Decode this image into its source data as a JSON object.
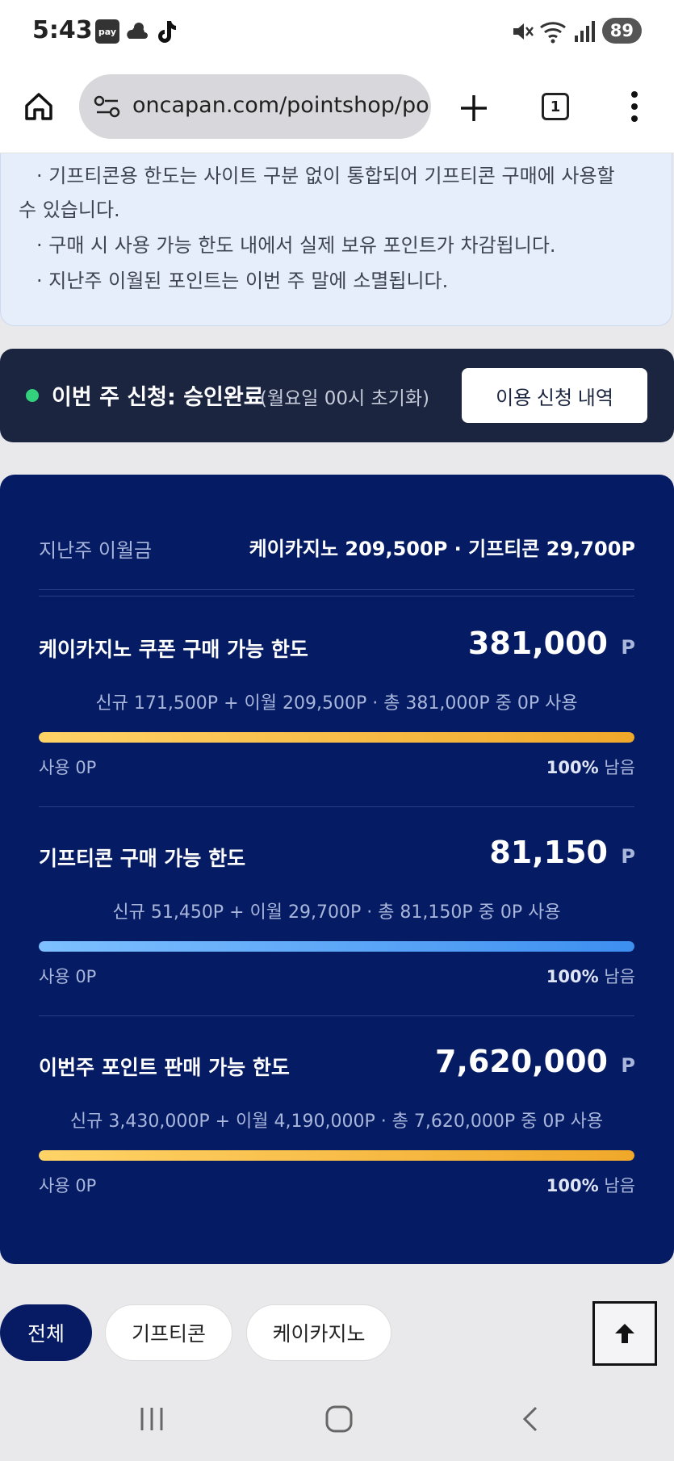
{
  "status_bar": {
    "time": "5:43",
    "pay_badge": "pay",
    "battery": "89"
  },
  "browser": {
    "url": "oncapan.com/pointshop/point",
    "tab_count": "1"
  },
  "notice": {
    "lines": [
      "· 기프티콘용 한도는 사이트 구분 없이 통합되어 기프티콘 구매에 사용할",
      "수 있습니다.",
      "· 구매 시 사용 가능 한도 내에서 실제 보유 포인트가 차감됩니다.",
      "· 지난주 이월된 포인트는 이번 주 말에 소멸됩니다."
    ]
  },
  "weekly_status": {
    "label": "이번 주 신청: 승인완료",
    "note": "(월요일 00시 초기화)",
    "indicator_color": "#34d17c",
    "history_button": "이용 신청 내역"
  },
  "carryover": {
    "label": "지난주 이월금",
    "value": "케이카지노 209,500P · 기프티콘 29,700P"
  },
  "limits": [
    {
      "title": "케이카지노 쿠폰 구매 가능 한도",
      "amount": "381,000",
      "unit": "P",
      "breakdown": "신규 171,500P + 이월 209,500P · 총 381,000P 중 0P 사용",
      "used": "사용 0P",
      "remain_pct": "100%",
      "remain_suffix": " 남음",
      "remaining_fraction": 1.0
    },
    {
      "title": "기프티콘 구매 가능 한도",
      "amount": "81,150",
      "unit": "P",
      "breakdown": "신규 51,450P + 이월 29,700P · 총 81,150P 중 0P 사용",
      "used": "사용 0P",
      "remain_pct": "100%",
      "remain_suffix": " 남음",
      "remaining_fraction": 1.0
    },
    {
      "title": "이번주 포인트 판매 가능 한도",
      "amount": "7,620,000",
      "unit": "P",
      "breakdown": "신규 3,430,000P + 이월 4,190,000P · 총 7,620,000P 중 0P 사용",
      "used": "사용 0P",
      "remain_pct": "100%",
      "remain_suffix": " 남음",
      "remaining_fraction": 1.0
    }
  ],
  "filters": {
    "all": "전체",
    "gifticon": "기프티콘",
    "kcasino": "케이카지노"
  },
  "colors": {
    "card_bg": "#051b63",
    "status_bg": "#1b2540",
    "gold_bar": "#f0a82a",
    "blue_bar": "#3d8ff0"
  }
}
